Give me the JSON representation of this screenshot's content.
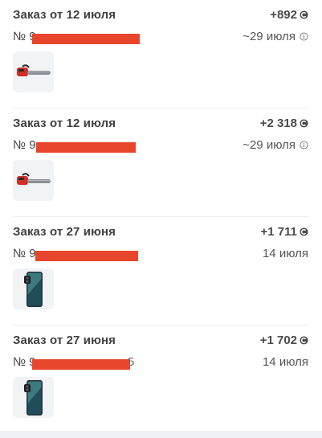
{
  "orders": [
    {
      "title": "Заказ от 12 июля",
      "amount": "+892",
      "num_prefix": "№ 9",
      "num_tail": "",
      "date": "~29 июля",
      "product_icon": "chainsaw-icon"
    },
    {
      "title": "Заказ от 12 июля",
      "amount": "+2 318",
      "num_prefix": "№ 9",
      "num_tail": "",
      "date": "~29 июля",
      "product_icon": "chainsaw-icon"
    },
    {
      "title": "Заказ от 27 июня",
      "amount": "+1 711",
      "num_prefix": "№ 9",
      "num_tail": "",
      "date": "14 июля",
      "product_icon": "smartphone-icon"
    },
    {
      "title": "Заказ от 27 июня",
      "amount": "+1 702",
      "num_prefix": "№ 9",
      "num_tail": "5",
      "date": "14 июля",
      "product_icon": "smartphone-icon"
    }
  ],
  "colors": {
    "redaction": "#e8462c",
    "divider": "#ededed",
    "text": "#404040"
  }
}
